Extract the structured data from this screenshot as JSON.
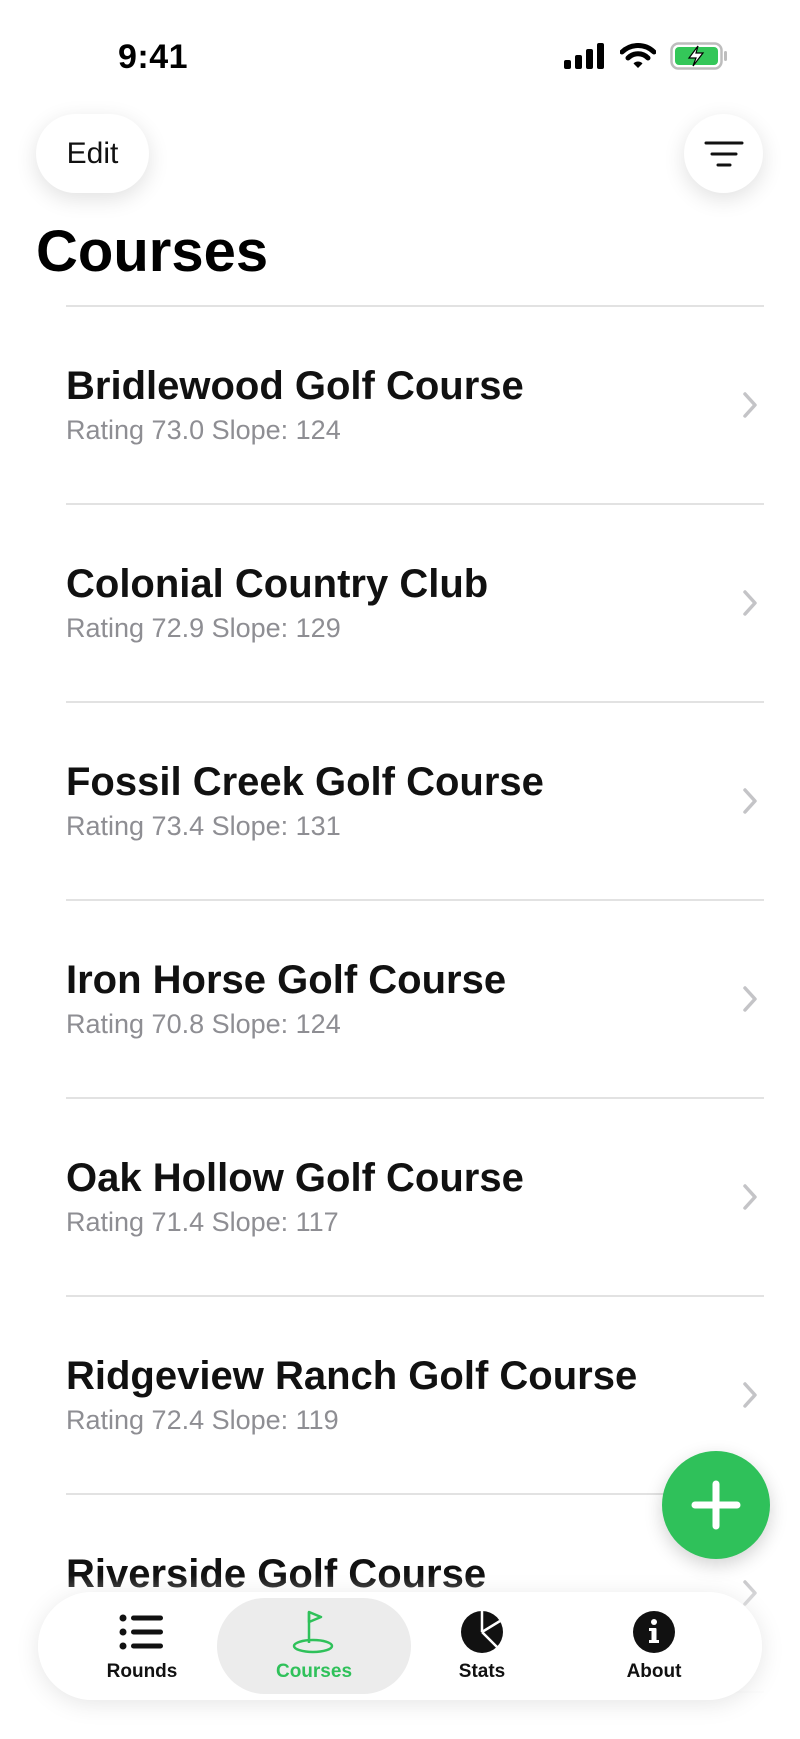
{
  "status_bar": {
    "time": "9:41",
    "icons": [
      "cellular-signal-icon",
      "wifi-icon",
      "battery-charging-icon"
    ],
    "battery_color": "#34c759"
  },
  "header": {
    "edit_label": "Edit",
    "filter_icon": "filter-lines-icon",
    "title": "Courses"
  },
  "courses": [
    {
      "name": "Bridlewood Golf Course",
      "subtitle": "Rating 73.0 Slope: 124"
    },
    {
      "name": "Colonial Country Club",
      "subtitle": "Rating 72.9 Slope: 129"
    },
    {
      "name": "Fossil Creek Golf Course",
      "subtitle": "Rating 73.4 Slope: 131"
    },
    {
      "name": "Iron Horse Golf Course",
      "subtitle": "Rating 70.8 Slope: 124"
    },
    {
      "name": "Oak Hollow Golf Course",
      "subtitle": "Rating 71.4 Slope: 117"
    },
    {
      "name": "Ridgeview Ranch Golf Course",
      "subtitle": "Rating 72.4 Slope: 119"
    },
    {
      "name": "Riverside Golf Course",
      "subtitle": ""
    }
  ],
  "fab": {
    "icon": "plus-icon",
    "color": "#2fc15a"
  },
  "tab_bar": {
    "tabs": [
      {
        "label": "Rounds",
        "icon": "list-icon"
      },
      {
        "label": "Courses",
        "icon": "golf-flag-icon",
        "selected": true
      },
      {
        "label": "Stats",
        "icon": "pie-chart-icon"
      },
      {
        "label": "About",
        "icon": "info-icon"
      }
    ],
    "accent_color": "#2fc15a"
  }
}
